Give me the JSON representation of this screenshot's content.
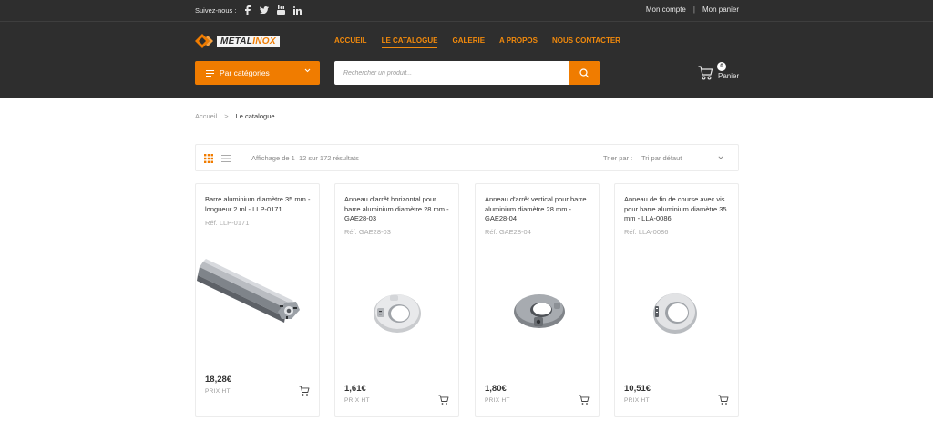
{
  "header": {
    "follow_label": "Suivez-nous :",
    "social": [
      "facebook-icon",
      "twitter-icon",
      "youtube-icon",
      "linkedin-icon"
    ],
    "account_label": "Mon compte",
    "separator": "|",
    "cart_link_label": "Mon panier",
    "logo_text_a": "METAL",
    "logo_text_b": "INOX",
    "nav": [
      {
        "label": "ACCUEIL",
        "active": false
      },
      {
        "label": "LE CATALOGUE",
        "active": true
      },
      {
        "label": "GALERIE",
        "active": false
      },
      {
        "label": "A PROPOS",
        "active": false
      },
      {
        "label": "NOUS CONTACTER",
        "active": false
      }
    ],
    "categories_label": "Par catégories",
    "search_placeholder": "Rechercher un produit...",
    "cart_count": "0",
    "cart_label": "Panier"
  },
  "breadcrumb": {
    "home": "Accueil",
    "separator": ">",
    "current": "Le catalogue"
  },
  "toolbar": {
    "results": "Affichage de 1–12 sur 172 résultats",
    "sort_label": "Trier par :",
    "sort_value": "Tri par défaut"
  },
  "products": [
    {
      "title": "Barre aluminium diamètre 35 mm - longueur 2 ml - LLP-0171",
      "ref": "Réf. LLP-0171",
      "price": "18,28€",
      "tax": "PRIX HT"
    },
    {
      "title": "Anneau d'arrêt horizontal pour barre aluminium diamètre 28 mm - GAE28-03",
      "ref": "Réf. GAE28-03",
      "price": "1,61€",
      "tax": "PRIX HT"
    },
    {
      "title": "Anneau d'arrêt vertical pour barre aluminium diamètre 28 mm - GAE28-04",
      "ref": "Réf. GAE28-04",
      "price": "1,80€",
      "tax": "PRIX HT"
    },
    {
      "title": "Anneau de fin de course avec vis pour barre aluminium diamètre 35 mm - LLA-0086",
      "ref": "Réf. LLA-0086",
      "price": "10,51€",
      "tax": "PRIX HT"
    }
  ],
  "colors": {
    "accent": "#f07c00",
    "header_bg": "#2e2e2e"
  }
}
